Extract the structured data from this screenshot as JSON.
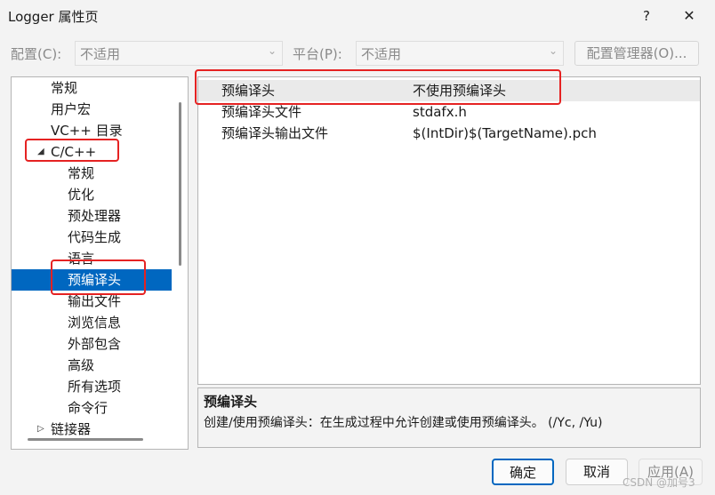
{
  "window": {
    "title": "Logger 属性页",
    "help_icon": "?",
    "close_icon": "✕"
  },
  "config_bar": {
    "config_label": "配置(C):",
    "config_value": "不适用",
    "platform_label": "平台(P):",
    "platform_value": "不适用",
    "manager_button": "配置管理器(O)..."
  },
  "tree": {
    "items": [
      {
        "label": "常规"
      },
      {
        "label": "用户宏"
      },
      {
        "label": "VC++ 目录"
      },
      {
        "label": "C/C++",
        "expanded": true
      },
      {
        "label": "常规"
      },
      {
        "label": "优化"
      },
      {
        "label": "预处理器"
      },
      {
        "label": "代码生成"
      },
      {
        "label": "语言"
      },
      {
        "label": "预编译头",
        "selected": true
      },
      {
        "label": "输出文件"
      },
      {
        "label": "浏览信息"
      },
      {
        "label": "外部包含"
      },
      {
        "label": "高级"
      },
      {
        "label": "所有选项"
      },
      {
        "label": "命令行"
      },
      {
        "label": "链接器",
        "expanded": false
      }
    ]
  },
  "properties": [
    {
      "name": "预编译头",
      "value": "不使用预编译头"
    },
    {
      "name": "预编译头文件",
      "value": "stdafx.h"
    },
    {
      "name": "预编译头输出文件",
      "value": "$(IntDir)$(TargetName).pch"
    }
  ],
  "description": {
    "title": "预编译头",
    "text": "创建/使用预编译头：在生成过程中允许创建或使用预编译头。      (/Yc, /Yu)"
  },
  "buttons": {
    "ok": "确定",
    "cancel": "取消",
    "apply": "应用(A)"
  },
  "watermark": "CSDN @加号3",
  "colors": {
    "selection": "#0067c0",
    "highlight_box": "#e52222"
  }
}
